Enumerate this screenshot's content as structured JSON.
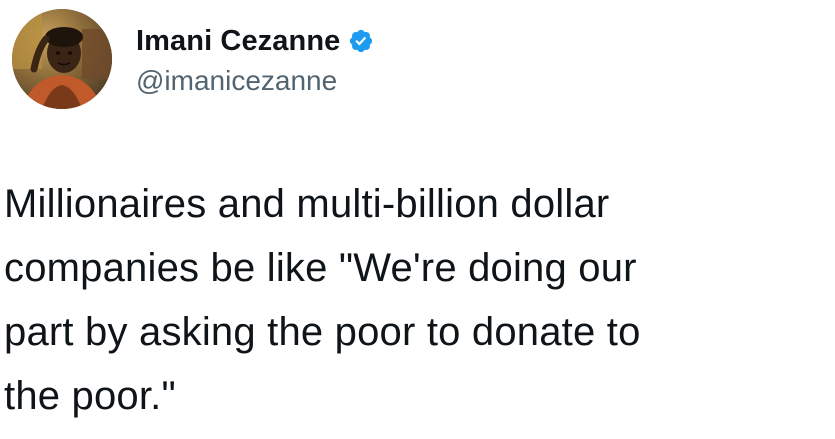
{
  "author": {
    "display_name": "Imani Cezanne",
    "handle": "@imanicezanne",
    "verified": true,
    "avatar_icon": "profile-photo",
    "verified_icon": "verified-badge-icon"
  },
  "tweet": {
    "text": "Millionaires and multi-billion dollar\ncompanies be like \"We're doing our\npart by asking the poor to donate to\nthe poor.\""
  },
  "colors": {
    "text_primary": "#0f1419",
    "text_secondary": "#536471",
    "verified_blue": "#1d9bf0",
    "background": "#ffffff"
  }
}
